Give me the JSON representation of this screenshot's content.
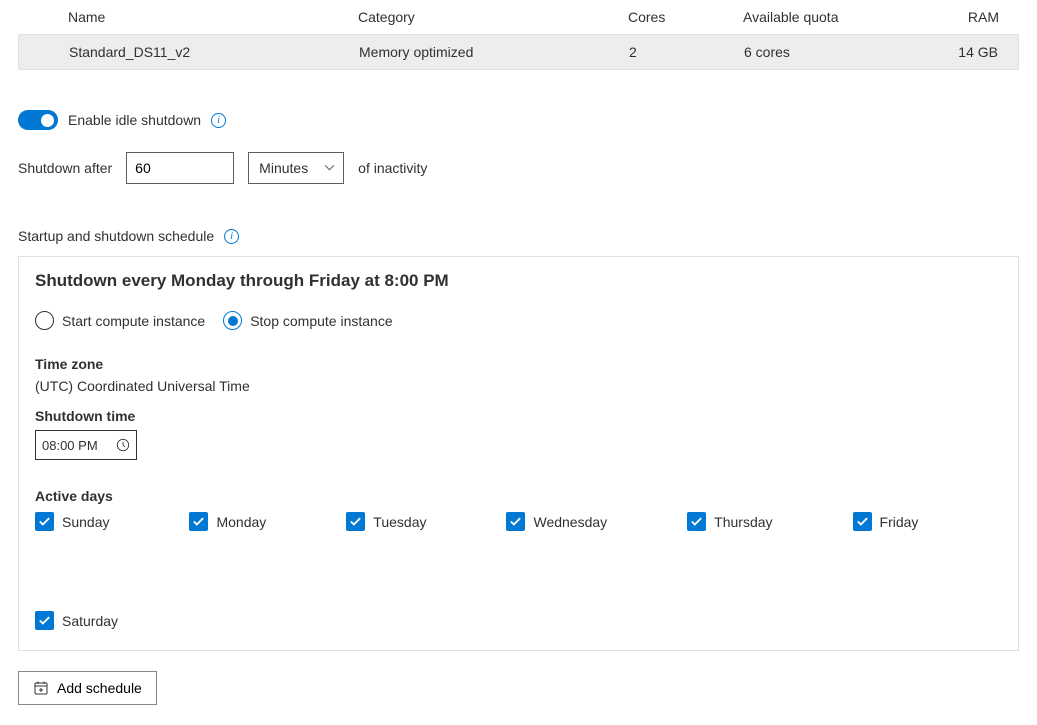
{
  "table": {
    "headers": {
      "name": "Name",
      "category": "Category",
      "cores": "Cores",
      "quota": "Available quota",
      "ram": "RAM"
    },
    "row": {
      "name": "Standard_DS11_v2",
      "category": "Memory optimized",
      "cores": "2",
      "quota": "6 cores",
      "ram": "14 GB"
    }
  },
  "idle": {
    "enable_label": "Enable idle shutdown",
    "shutdown_after_label": "Shutdown after",
    "value": "60",
    "unit": "Minutes",
    "suffix": "of inactivity"
  },
  "schedule_section": {
    "title": "Startup and shutdown schedule"
  },
  "schedule": {
    "heading": "Shutdown every Monday through Friday at 8:00 PM",
    "start_label": "Start compute instance",
    "stop_label": "Stop compute instance",
    "tz_label": "Time zone",
    "tz_value": "(UTC) Coordinated Universal Time",
    "time_label": "Shutdown time",
    "time_value": "08:00 PM",
    "active_label": "Active days",
    "days": [
      "Sunday",
      "Monday",
      "Tuesday",
      "Wednesday",
      "Thursday",
      "Friday",
      "Saturday"
    ]
  },
  "add_schedule_label": "Add schedule"
}
